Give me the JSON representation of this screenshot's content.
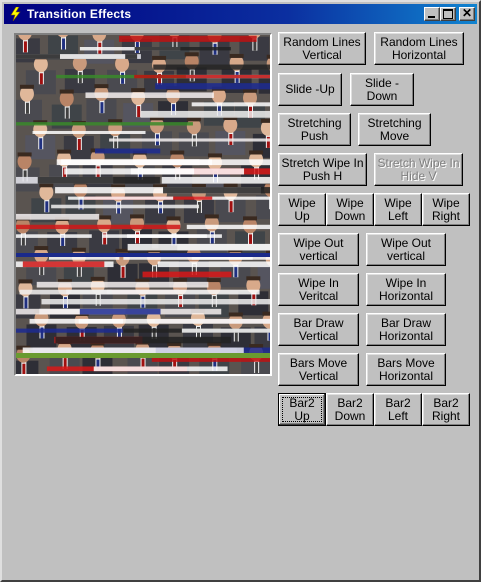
{
  "window": {
    "title": "Transition Effects"
  },
  "buttons": {
    "random_lines_vertical": [
      "Random Lines",
      "Vertical"
    ],
    "random_lines_horizontal": [
      "Random Lines",
      "Horizontal"
    ],
    "slide_up": [
      "Slide -Up"
    ],
    "slide_down": [
      "Slide -Down"
    ],
    "stretching_push": [
      "Stretching",
      "Push"
    ],
    "stretching_move": [
      "Stretching",
      "Move"
    ],
    "stretch_wipe_in_push_h": [
      "Stretch Wipe In",
      "Push H"
    ],
    "stretch_wipe_in_hide_v": [
      "Stretch Wipe In",
      "Hide V"
    ],
    "wipe_up": [
      "Wipe",
      "Up"
    ],
    "wipe_down": [
      "Wipe",
      "Down"
    ],
    "wipe_left": [
      "Wipe",
      "Left"
    ],
    "wipe_right": [
      "Wipe",
      "Right"
    ],
    "wipe_out_vertical": [
      "Wipe Out",
      "vertical"
    ],
    "wipe_out_vertical_2": [
      "Wipe Out",
      "vertical"
    ],
    "wipe_in_vertical": [
      "Wipe In",
      "Veritcal"
    ],
    "wipe_in_horizontal": [
      "Wipe In",
      "Horizontal"
    ],
    "bar_draw_vertical": [
      "Bar Draw",
      "Vertical"
    ],
    "bar_draw_horizontal": [
      "Bar Draw",
      "Horizontal"
    ],
    "bars_move_vertical": [
      "Bars Move",
      "Vertical"
    ],
    "bars_move_horizontal": [
      "Bars Move",
      "Horizontal"
    ],
    "bar2_up": [
      "Bar2",
      "Up"
    ],
    "bar2_down": [
      "Bar2",
      "Down"
    ],
    "bar2_left": [
      "Bar2",
      "Left"
    ],
    "bar2_right": [
      "Bar2",
      "Right"
    ]
  },
  "state": {
    "disabled_button": "stretch_wipe_in_hide_v",
    "focused_button": "bar2_up"
  },
  "colors": {
    "titlebar_start": "#000080",
    "titlebar_end": "#1084d0",
    "face": "#c0c0c0"
  }
}
